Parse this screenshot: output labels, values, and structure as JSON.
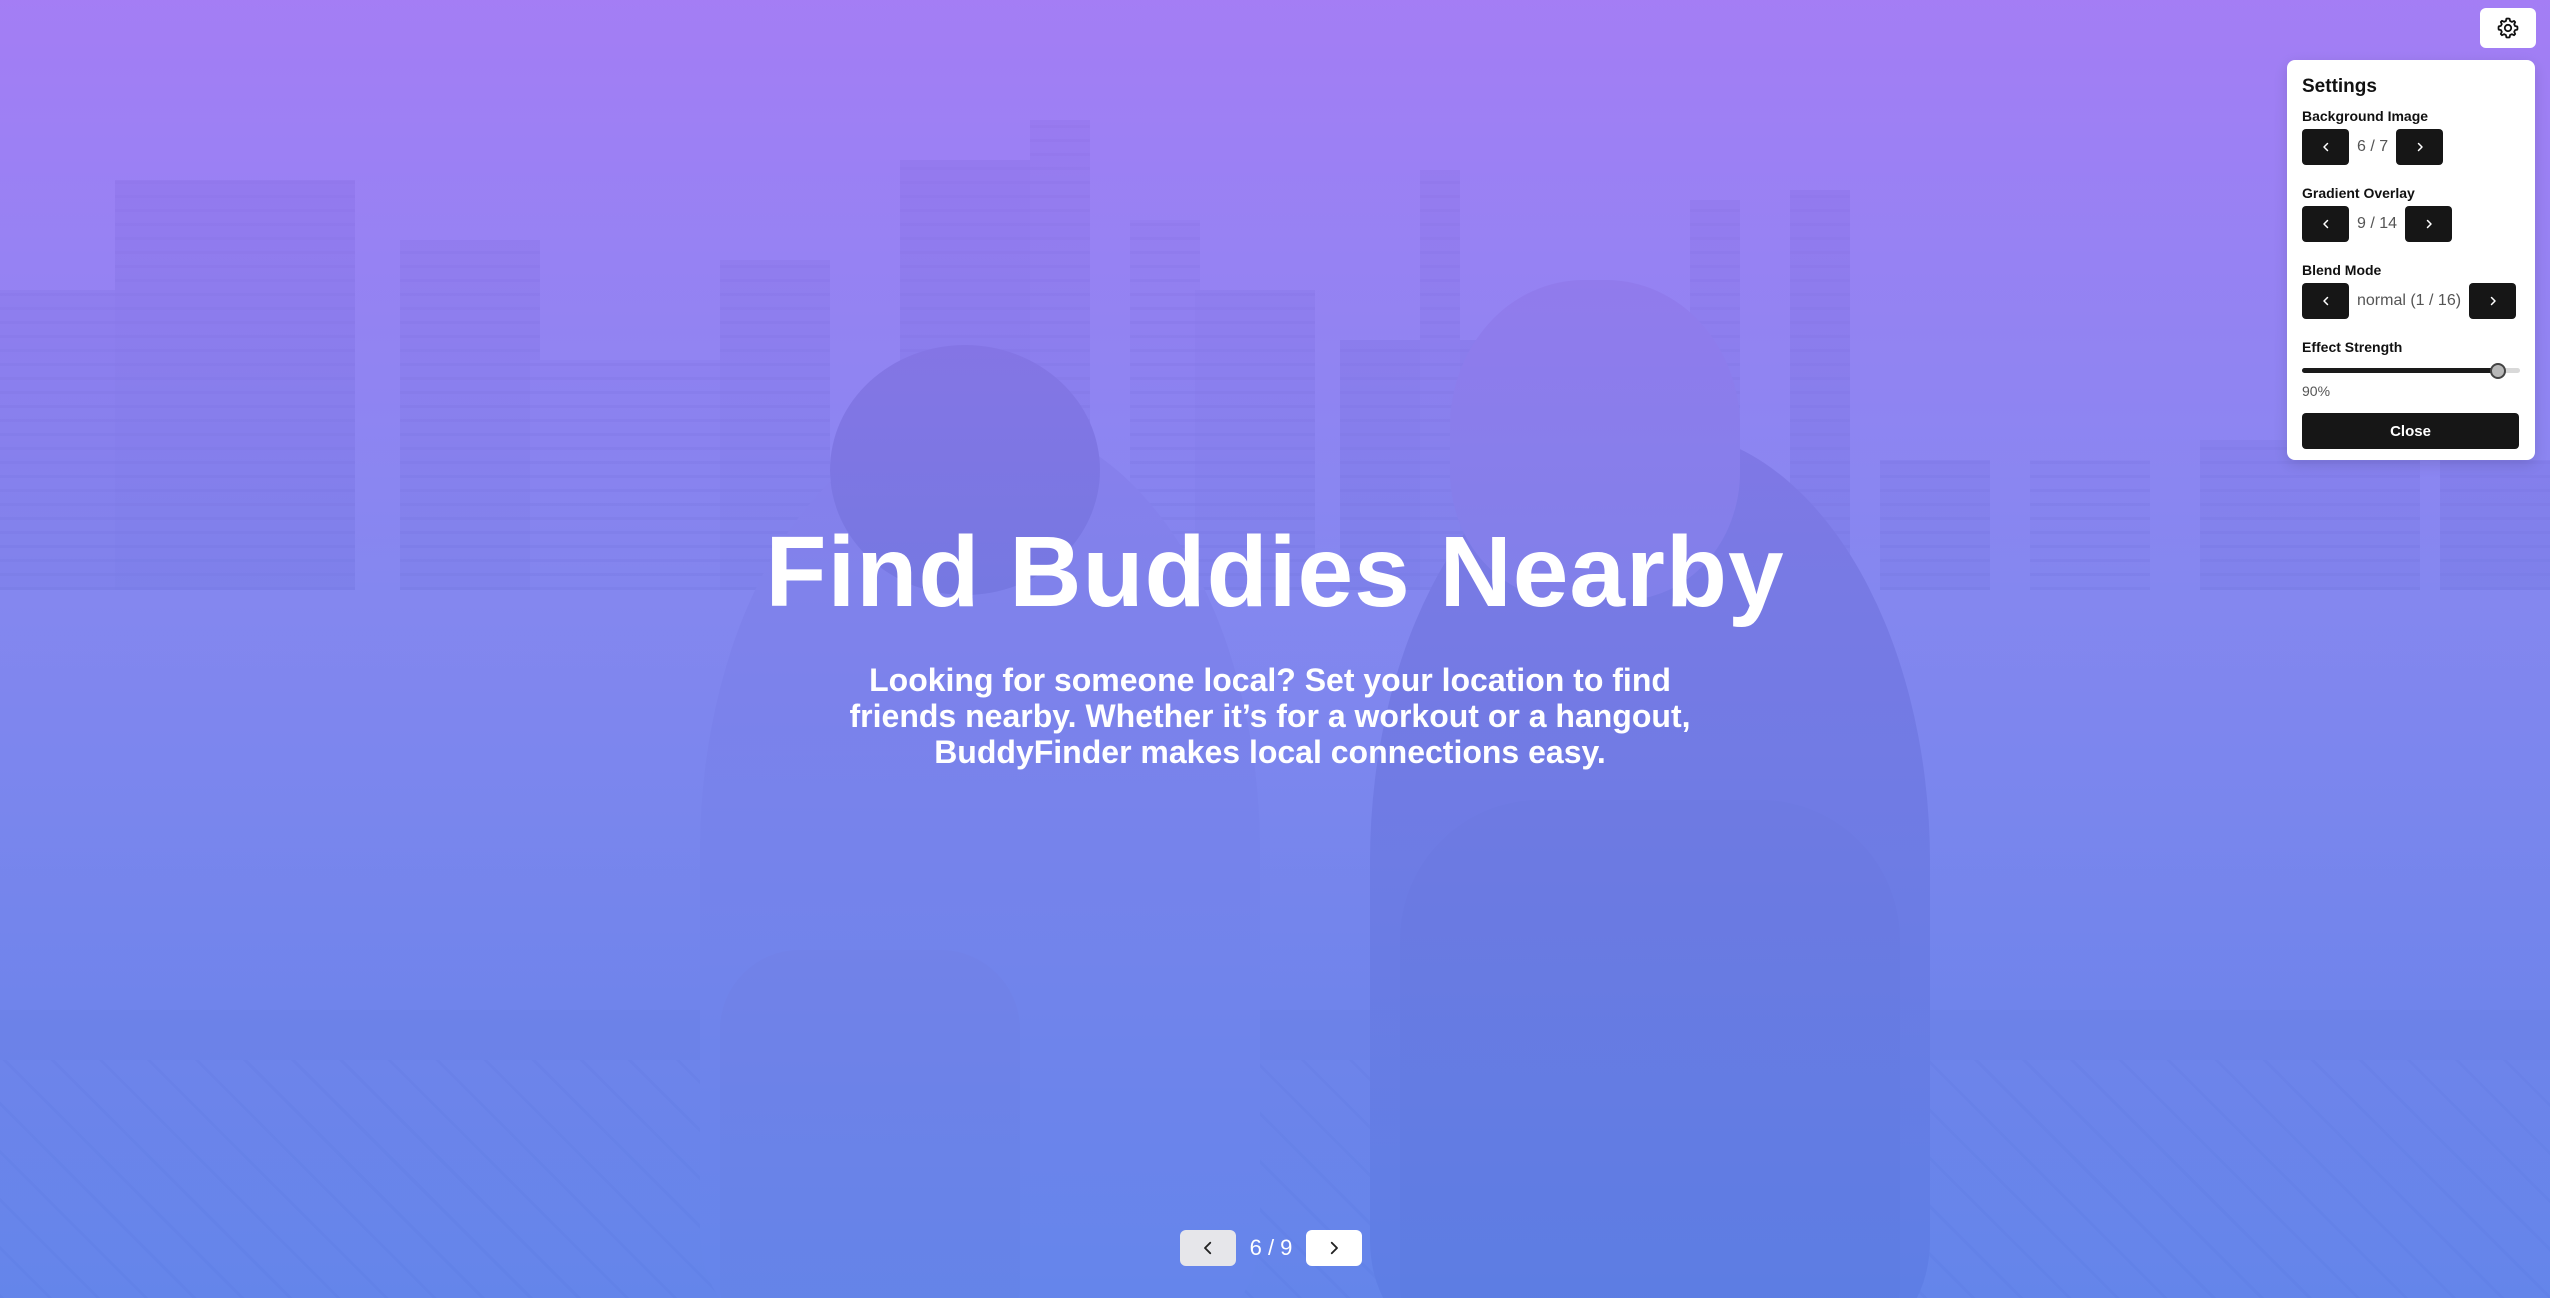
{
  "hero": {
    "title": "Find Buddies Nearby",
    "description": "Looking for someone local? Set your location to find friends nearby. Whether it’s for a workout or a hangout, BuddyFinder makes local connections easy."
  },
  "pager": {
    "counter": "6 / 9"
  },
  "settings": {
    "title": "Settings",
    "background_image": {
      "label": "Background Image",
      "value": "6 / 7"
    },
    "gradient_overlay": {
      "label": "Gradient Overlay",
      "value": "9 / 14"
    },
    "blend_mode": {
      "label": "Blend Mode",
      "value": "normal (1 / 16)"
    },
    "effect_strength": {
      "label": "Effect Strength",
      "value_text": "90%",
      "value": 0.9
    },
    "close_label": "Close"
  },
  "colors": {
    "overlay_top": "#a076f6",
    "overlay_bottom": "#6084f2",
    "button_dark": "#161616"
  },
  "icons": {
    "gear": "gear-icon",
    "prev": "chevron-left-icon",
    "next": "chevron-right-icon"
  }
}
